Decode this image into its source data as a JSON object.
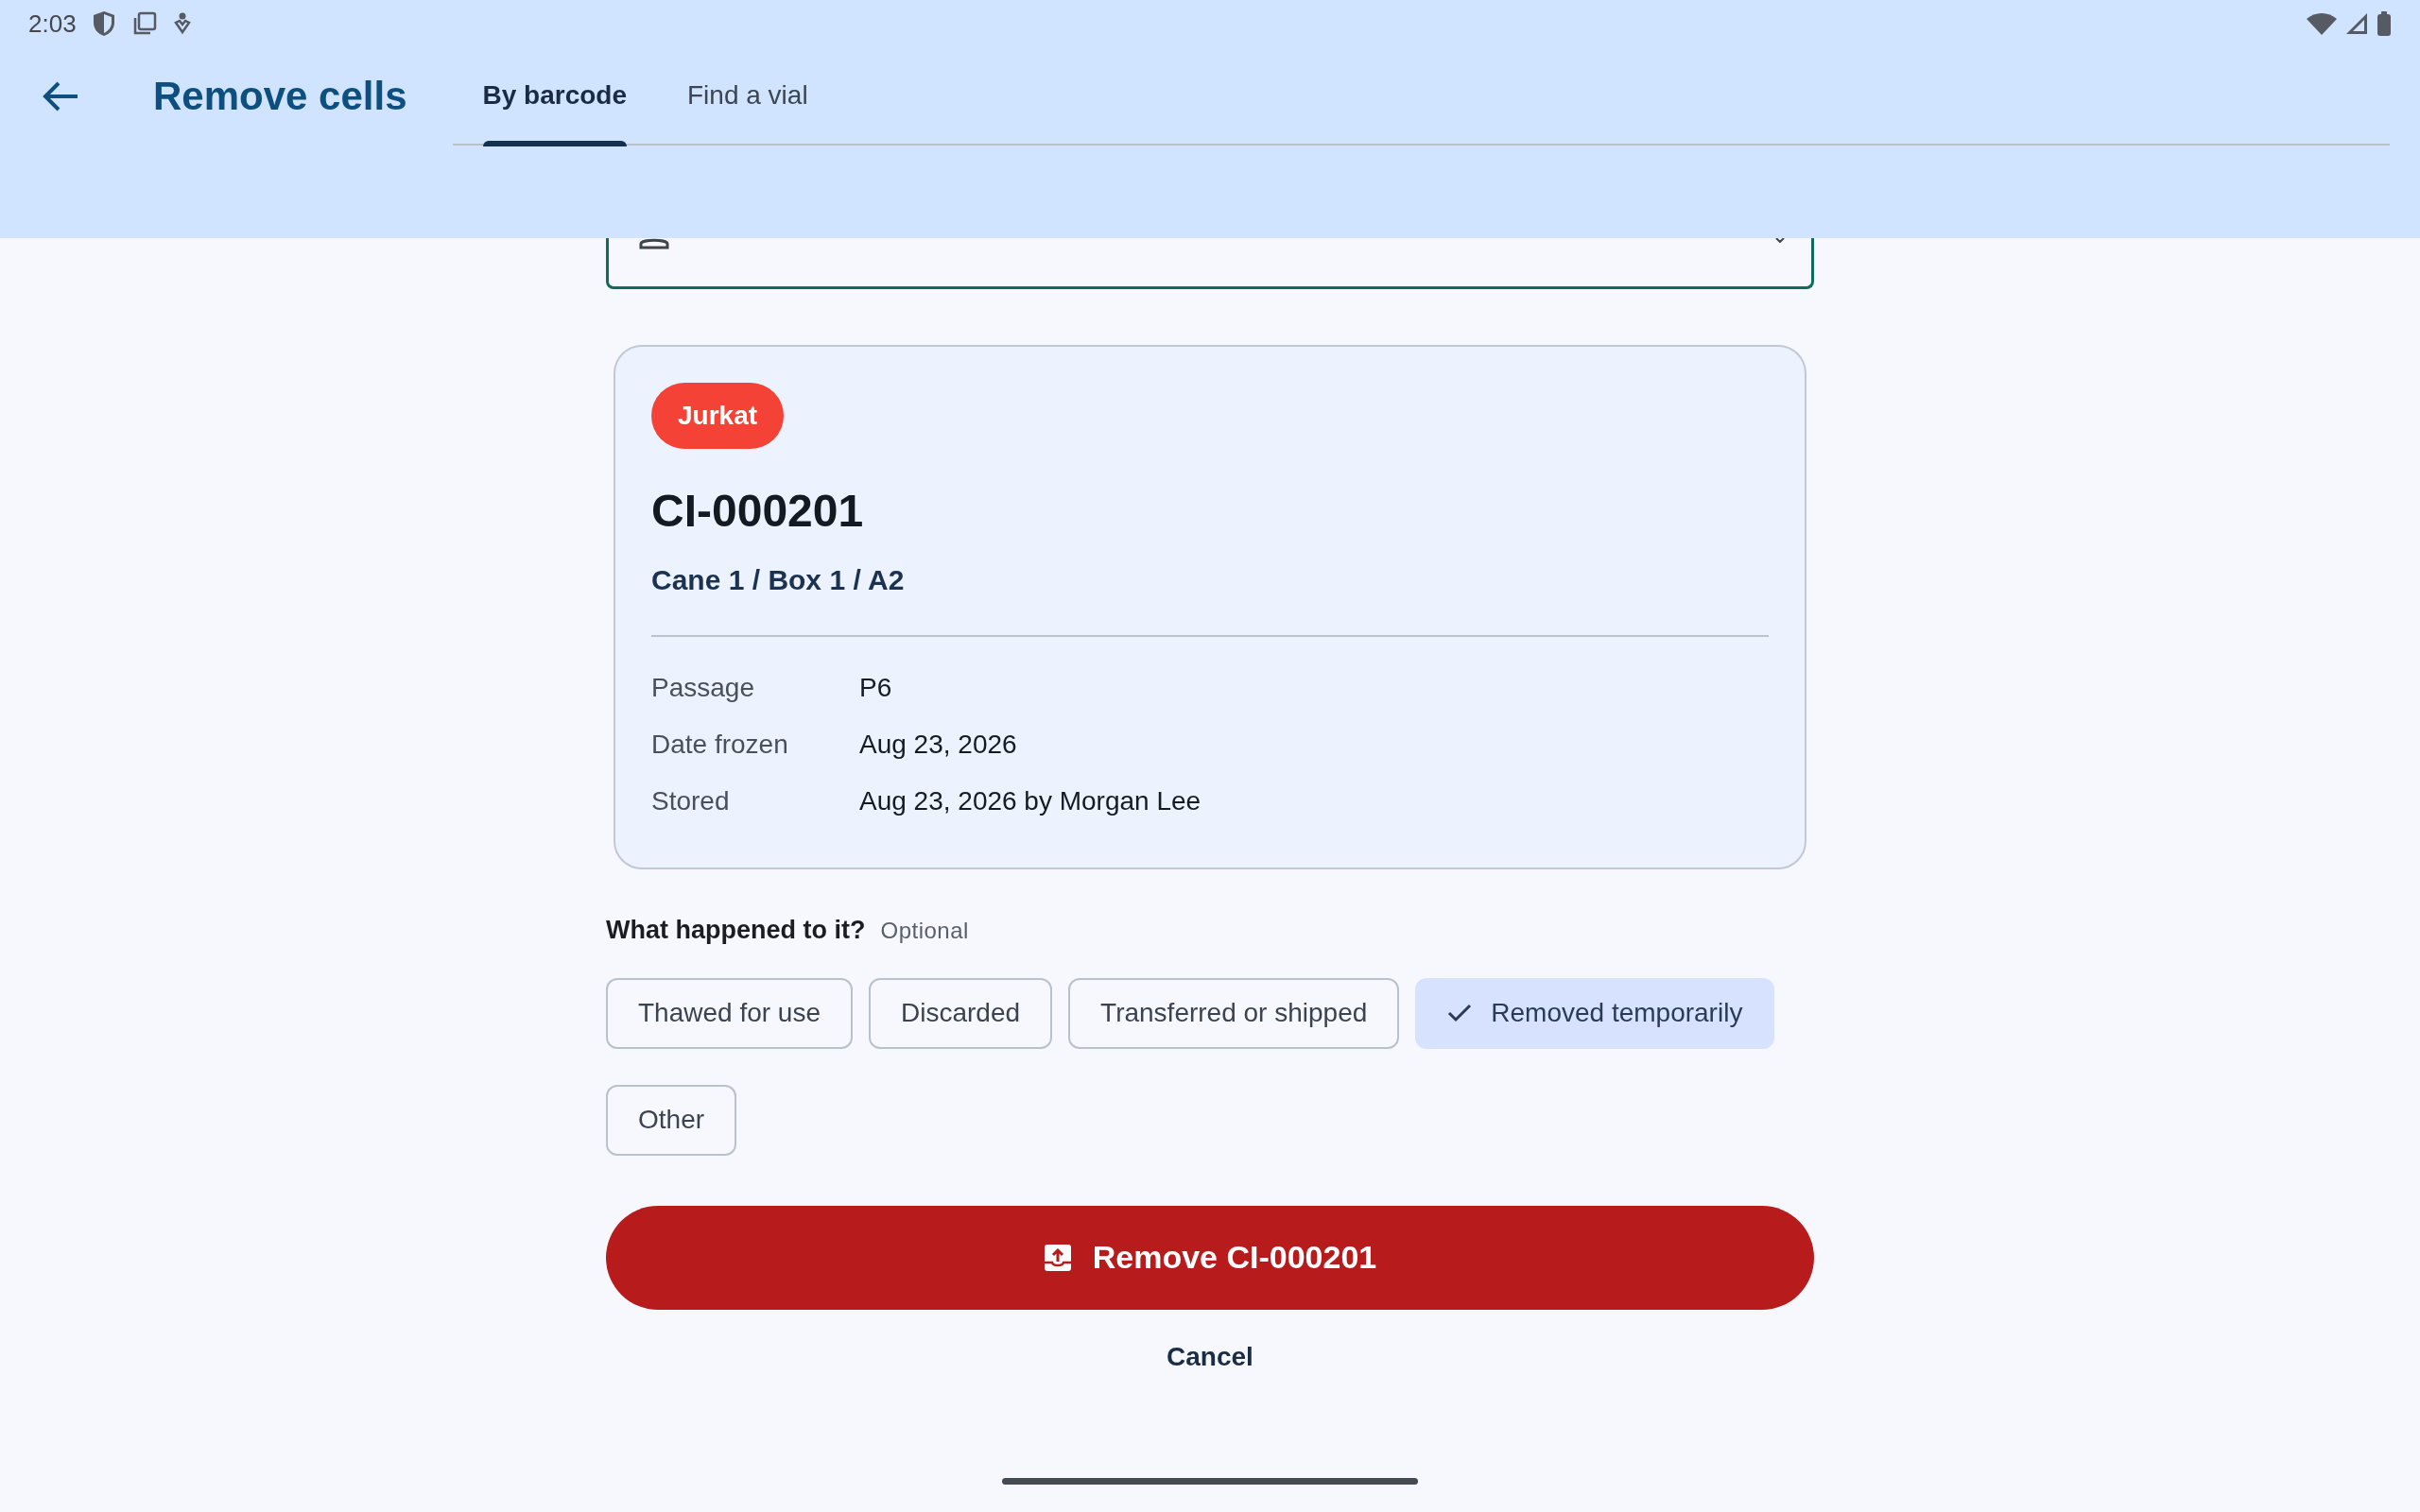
{
  "status_bar": {
    "time": "2:03"
  },
  "app_bar": {
    "title": "Remove cells",
    "tabs": [
      {
        "label": "By barcode",
        "selected": true
      },
      {
        "label": "Find a vial",
        "selected": false
      }
    ]
  },
  "vial_card": {
    "tag": "Jurkat",
    "id": "CI-000201",
    "location": "Cane 1 / Box 1 / A2",
    "details": [
      {
        "label": "Passage",
        "value": "P6"
      },
      {
        "label": "Date frozen",
        "value": "Aug 23, 2026"
      },
      {
        "label": "Stored",
        "value": "Aug 23, 2026 by Morgan Lee"
      }
    ]
  },
  "reason": {
    "label": "What happened to it?",
    "hint": "Optional",
    "options": [
      {
        "label": "Thawed for use",
        "selected": false
      },
      {
        "label": "Discarded",
        "selected": false
      },
      {
        "label": "Transferred or shipped",
        "selected": false
      },
      {
        "label": "Removed temporarily",
        "selected": true
      },
      {
        "label": "Other",
        "selected": false
      }
    ]
  },
  "remove_button": {
    "label": "Remove CI-000201"
  },
  "cancel_button": {
    "label": "Cancel"
  }
}
